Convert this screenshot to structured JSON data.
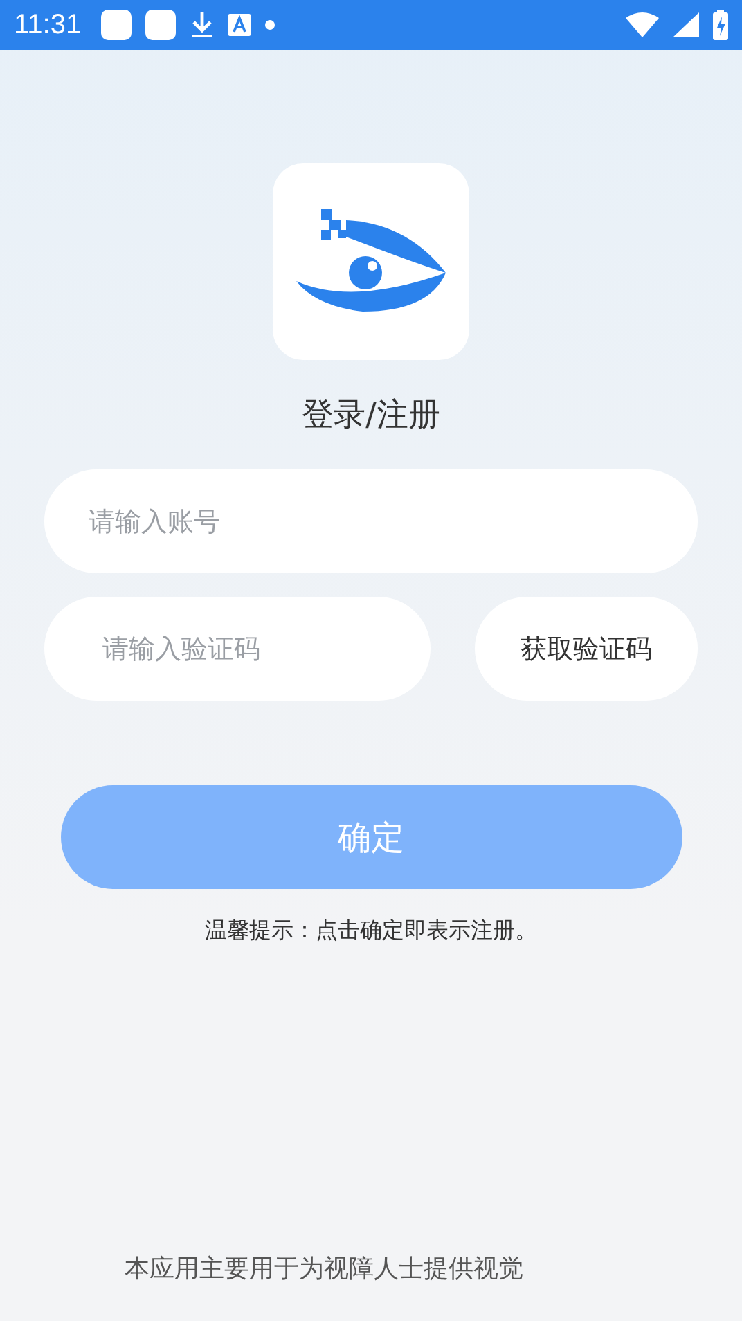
{
  "status_bar": {
    "time": "11:31"
  },
  "title": "登录/注册",
  "account_field": {
    "placeholder": "请输入账号"
  },
  "code_field": {
    "placeholder": "请输入验证码"
  },
  "get_code_button": "获取验证码",
  "confirm_button": "确定",
  "hint": "温馨提示：点击确定即表示注册。",
  "footer": "本应用主要用于为视障人士提供视觉"
}
